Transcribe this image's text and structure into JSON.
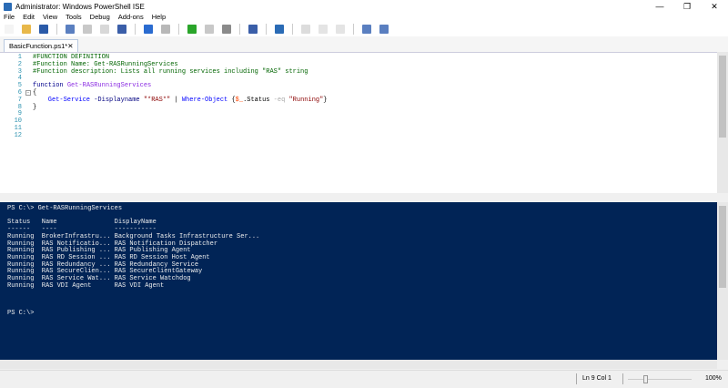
{
  "window": {
    "title": "Administrator: Windows PowerShell ISE",
    "minimize": "—",
    "maximize": "❐",
    "close": "✕"
  },
  "menu": [
    "File",
    "Edit",
    "View",
    "Tools",
    "Debug",
    "Add-ons",
    "Help"
  ],
  "toolbar": [
    {
      "name": "new-icon",
      "color": "#f4f4f4"
    },
    {
      "name": "open-icon",
      "color": "#e8b84a"
    },
    {
      "name": "save-icon",
      "color": "#2a5aa8"
    },
    {
      "sep": true
    },
    {
      "name": "cut-icon",
      "color": "#5a7fc0"
    },
    {
      "name": "copy-icon",
      "color": "#c8c8c8"
    },
    {
      "name": "paste-icon",
      "color": "#d8d8d8"
    },
    {
      "name": "clear-console-icon",
      "color": "#3a5ea8"
    },
    {
      "sep": true
    },
    {
      "name": "undo-icon",
      "color": "#2a6bd0"
    },
    {
      "name": "redo-icon",
      "color": "#b8b8b8"
    },
    {
      "sep": true
    },
    {
      "name": "run-script-icon",
      "color": "#2aa52a"
    },
    {
      "name": "run-selection-icon",
      "color": "#c8c8c8"
    },
    {
      "name": "stop-icon",
      "color": "#8a8a8a"
    },
    {
      "sep": true
    },
    {
      "name": "new-remote-tab-icon",
      "color": "#3a5ea8"
    },
    {
      "sep": true
    },
    {
      "name": "start-powershell-icon",
      "color": "#2a6bb5"
    },
    {
      "sep": true
    },
    {
      "name": "script-pane-top-icon",
      "color": "#dcdcdc"
    },
    {
      "name": "script-pane-right-icon",
      "color": "#e4e4e4"
    },
    {
      "name": "script-pane-max-icon",
      "color": "#e4e4e4"
    },
    {
      "sep": true
    },
    {
      "name": "show-script-pane-icon",
      "color": "#5a7fc0"
    },
    {
      "name": "show-commands-icon",
      "color": "#5a7fc0"
    }
  ],
  "tab": {
    "label": "BasicFunction.ps1*",
    "close": "✕"
  },
  "editor": {
    "line_numbers": [
      "1",
      "2",
      "3",
      "4",
      "5",
      "6",
      "7",
      "8",
      "9",
      "10",
      "11",
      "12"
    ],
    "lines": [
      [
        {
          "t": "#FUNCTION DEFINITION",
          "c": "comment"
        }
      ],
      [
        {
          "t": "#Function Name: Get-RASRunningServices",
          "c": "comment"
        }
      ],
      [
        {
          "t": "#Function description: Lists all running services including \"RAS\" string",
          "c": "comment"
        }
      ],
      [],
      [
        {
          "t": "function ",
          "c": "kw"
        },
        {
          "t": "Get-RASRunningServices",
          "c": "fn"
        }
      ],
      [
        {
          "t": "{",
          "c": "plain"
        }
      ],
      [
        {
          "t": "    Get-Service ",
          "c": "cmd"
        },
        {
          "t": "-Displayname ",
          "c": "param"
        },
        {
          "t": "\"*RAS*\"",
          "c": "str"
        },
        {
          "t": " | ",
          "c": "plain"
        },
        {
          "t": "Where-Object ",
          "c": "cmd"
        },
        {
          "t": "{",
          "c": "plain"
        },
        {
          "t": "$_",
          "c": "var"
        },
        {
          "t": ".Status ",
          "c": "plain"
        },
        {
          "t": "-eq ",
          "c": "op"
        },
        {
          "t": "\"Running\"",
          "c": "str"
        },
        {
          "t": "}",
          "c": "plain"
        }
      ],
      [
        {
          "t": "}",
          "c": "plain"
        }
      ],
      [],
      [],
      [],
      []
    ]
  },
  "console": {
    "lines": [
      "PS C:\\> Get-RASRunningServices",
      "",
      "Status   Name               DisplayName",
      "------   ----               -----------",
      "Running  BrokerInfrastru... Background Tasks Infrastructure Ser...",
      "Running  RAS Notificatio... RAS Notification Dispatcher",
      "Running  RAS Publishing ... RAS Publishing Agent",
      "Running  RAS RD Session ... RAS RD Session Host Agent",
      "Running  RAS Redundancy ... RAS Redundancy Service",
      "Running  RAS SecureClien... RAS SecureClientGateway",
      "Running  RAS Service Wat... RAS Service Watchdog",
      "Running  RAS VDI Agent      RAS VDI Agent",
      "",
      "",
      "",
      "PS C:\\>"
    ]
  },
  "status": {
    "position": "Ln 9  Col 1",
    "zoom": "100%",
    "zoom_level_percent": 100
  }
}
